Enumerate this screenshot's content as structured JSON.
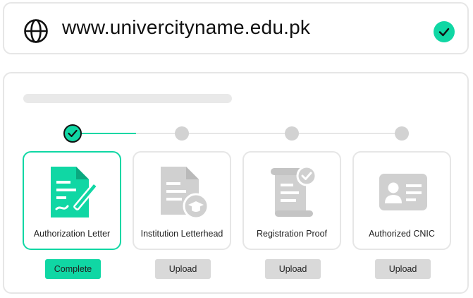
{
  "address_bar": {
    "url": "www.univercityname.edu.pk",
    "globe_icon": "globe-icon",
    "status_icon": "verified-check-icon"
  },
  "colors": {
    "accent": "#10d7a4",
    "inactive": "#d2d2d2",
    "button_inactive": "#d9d9d9",
    "border": "#e6e6e6"
  },
  "stepper": {
    "steps": [
      {
        "state": "complete"
      },
      {
        "state": "pending"
      },
      {
        "state": "pending"
      },
      {
        "state": "pending"
      }
    ]
  },
  "documents": [
    {
      "label": "Authorization Letter",
      "icon": "signed-document-icon",
      "status": "Complete",
      "active": true
    },
    {
      "label": "Institution Letterhead",
      "icon": "letterhead-graduation-icon",
      "status": "Upload",
      "active": false
    },
    {
      "label": "Registration Proof",
      "icon": "verified-scroll-icon",
      "status": "Upload",
      "active": false
    },
    {
      "label": "Authorized CNIC",
      "icon": "id-card-icon",
      "status": "Upload",
      "active": false
    }
  ]
}
